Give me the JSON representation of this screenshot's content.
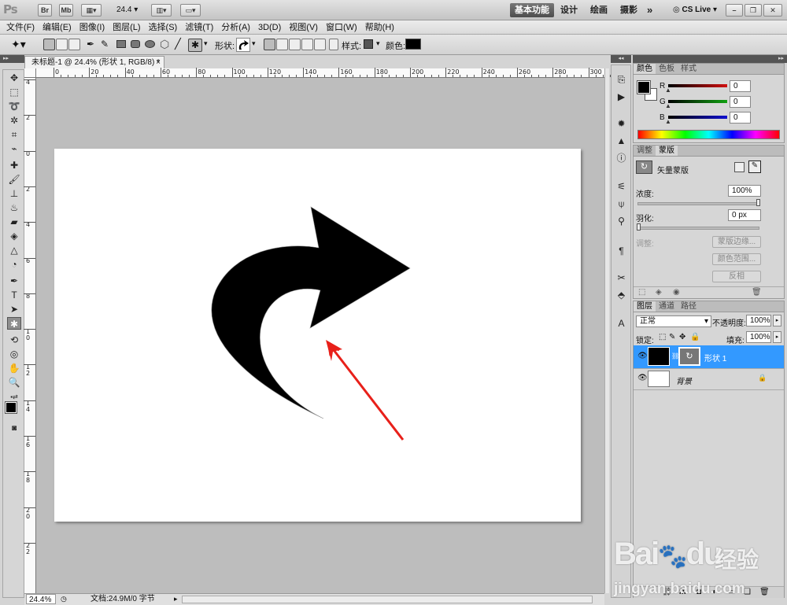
{
  "app": {
    "logo": "Ps",
    "bridge": "Br",
    "minibridge": "Mb",
    "zoom_select": "24.4"
  },
  "workspaces": {
    "essentials": "基本功能",
    "design": "设计",
    "painting": "绘画",
    "photography": "摄影",
    "more": "»",
    "cslive": "CS Live"
  },
  "menu": [
    "文件(F)",
    "编辑(E)",
    "图像(I)",
    "图层(L)",
    "选择(S)",
    "滤镜(T)",
    "分析(A)",
    "3D(D)",
    "视图(V)",
    "窗口(W)",
    "帮助(H)"
  ],
  "options": {
    "shape_label": "形状:",
    "style_label": "样式:",
    "color_label": "颜色:",
    "color_value": "#000000"
  },
  "document": {
    "tab_title": "未标题-1 @ 24.4% (形状 1, RGB/8) *",
    "close": "×"
  },
  "rulers": {
    "h": [
      "0",
      "20",
      "40",
      "60",
      "80",
      "100",
      "120",
      "140",
      "160",
      "180",
      "200",
      "220",
      "240",
      "260",
      "280",
      "300"
    ],
    "v": [
      "4",
      "2",
      "0",
      "2",
      "4",
      "6",
      "8",
      "10",
      "12",
      "14",
      "16",
      "18",
      "20",
      "22"
    ]
  },
  "status": {
    "zoom": "24.4%",
    "doc_info": "文档:24.9M/0 字节"
  },
  "color_panel": {
    "tabs": [
      "颜色",
      "色板",
      "样式"
    ],
    "channels": [
      {
        "name": "R",
        "value": "0",
        "color": "#d01010"
      },
      {
        "name": "G",
        "value": "0",
        "color": "#10a010"
      },
      {
        "name": "B",
        "value": "0",
        "color": "#1010d0"
      }
    ]
  },
  "masks_panel": {
    "tabs": [
      "调整",
      "蒙版"
    ],
    "title": "矢量蒙版",
    "density_label": "浓度:",
    "density_value": "100%",
    "feather_label": "羽化:",
    "feather_value": "0 px",
    "refine_label": "调整:",
    "buttons": [
      "蒙版边缘...",
      "颜色范围...",
      "反相"
    ]
  },
  "layers_panel": {
    "tabs": [
      "图层",
      "通道",
      "路径"
    ],
    "blend_mode": "正常",
    "opacity_label": "不透明度:",
    "opacity_value": "100%",
    "lock_label": "锁定:",
    "fill_label": "填充:",
    "fill_value": "100%",
    "layers": [
      {
        "name": "形状 1",
        "selected": true
      },
      {
        "name": "背景",
        "selected": false
      }
    ],
    "footer_icons": [
      "link-icon",
      "fx-icon",
      "mask-icon",
      "adjustment-icon",
      "group-icon",
      "new-layer-icon",
      "trash-icon"
    ]
  },
  "accent": {
    "selected_layer": "#3399ff",
    "arrow_annotation": "#e8201a"
  },
  "watermark": {
    "brand": "Bai",
    "brand2": "du",
    "cn": "经验",
    "url": "jingyan.baidu.com"
  }
}
